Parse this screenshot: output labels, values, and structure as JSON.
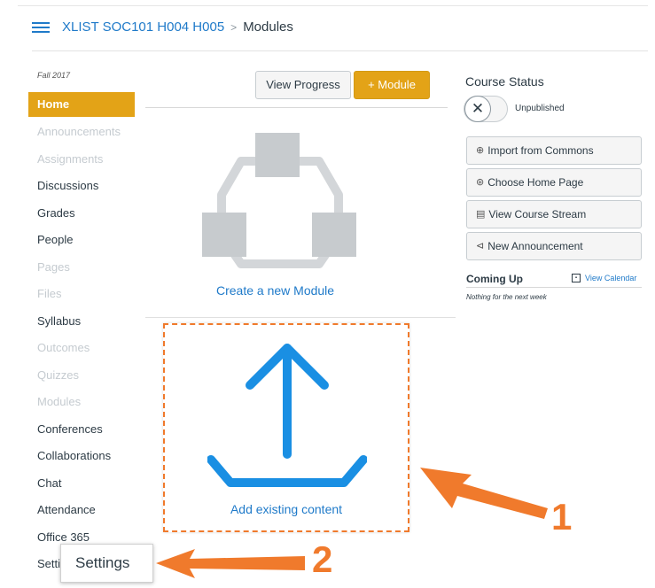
{
  "header": {
    "course": "XLIST SOC101 H004 H005",
    "separator": ">",
    "current": "Modules"
  },
  "sidebar": {
    "term": "Fall 2017",
    "items": [
      {
        "label": "Home",
        "state": "active"
      },
      {
        "label": "Announcements",
        "state": "disabled"
      },
      {
        "label": "Assignments",
        "state": "disabled"
      },
      {
        "label": "Discussions",
        "state": "enabled"
      },
      {
        "label": "Grades",
        "state": "enabled"
      },
      {
        "label": "People",
        "state": "enabled"
      },
      {
        "label": "Pages",
        "state": "disabled"
      },
      {
        "label": "Files",
        "state": "disabled"
      },
      {
        "label": "Syllabus",
        "state": "enabled"
      },
      {
        "label": "Outcomes",
        "state": "disabled"
      },
      {
        "label": "Quizzes",
        "state": "disabled"
      },
      {
        "label": "Modules",
        "state": "disabled"
      },
      {
        "label": "Conferences",
        "state": "enabled"
      },
      {
        "label": "Collaborations",
        "state": "enabled"
      },
      {
        "label": "Chat",
        "state": "enabled"
      },
      {
        "label": "Attendance",
        "state": "enabled"
      },
      {
        "label": "Office 365",
        "state": "enabled"
      },
      {
        "label": "Setti",
        "state": "enabled"
      }
    ]
  },
  "toolbar": {
    "view_progress": "View Progress",
    "add_module": "+ Module"
  },
  "main": {
    "create_module": "Create a new Module",
    "add_existing": "Add existing content"
  },
  "course_status": {
    "title": "Course Status",
    "toggle_icon": "✕",
    "state": "Unpublished"
  },
  "side_buttons": [
    {
      "label": "Import from Commons",
      "icon": "⊕"
    },
    {
      "label": "Choose Home Page",
      "icon": "⊛"
    },
    {
      "label": "View Course Stream",
      "icon": "▤"
    },
    {
      "label": "New Announcement",
      "icon": "⊲"
    }
  ],
  "coming_up": {
    "title": "Coming Up",
    "view_calendar": "View Calendar",
    "empty": "Nothing for the next week"
  },
  "callouts": {
    "settings_popup": "Settings",
    "num1": "1",
    "num2": "2"
  },
  "colors": {
    "accent": "#e3a317",
    "link": "#1f7ac9",
    "callout": "#f07a2c"
  }
}
